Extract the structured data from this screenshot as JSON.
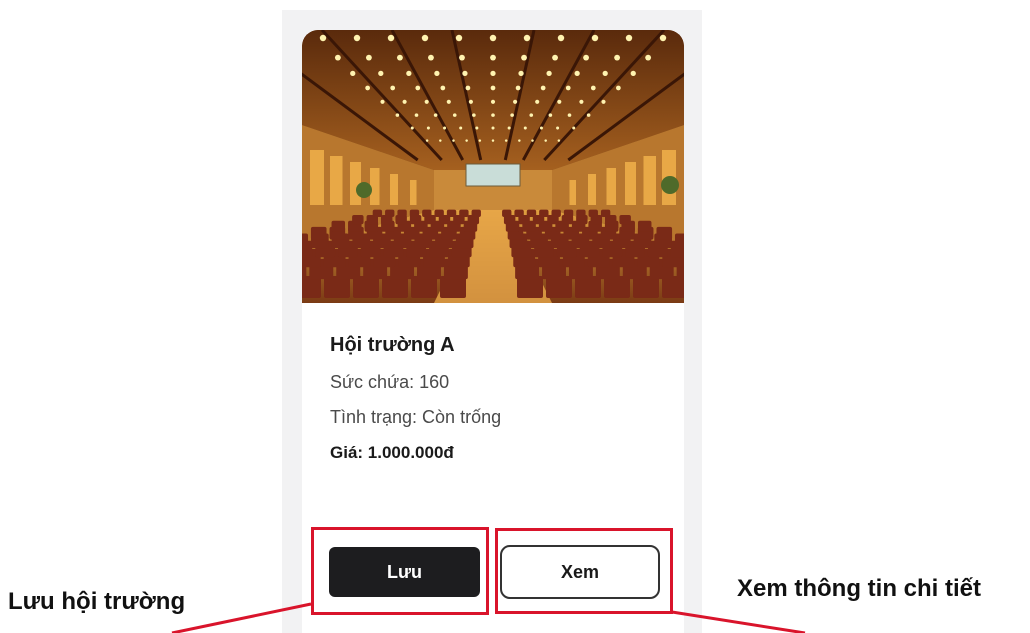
{
  "card": {
    "image": {
      "subject": "conference-hall-photo",
      "colors": {
        "ceiling": "#8a4a1c",
        "light": "#fff3b0",
        "walls": "#b8772e",
        "seats": "#7a2a17",
        "floor": "#d58a2c"
      }
    },
    "hall_name": "Hội trường A",
    "capacity": "Sức chứa: 160",
    "status": "Tình trạng: Còn trống",
    "price": "Giá: 1.000.000đ"
  },
  "buttons": {
    "save_label": "Lưu",
    "view_label": "Xem"
  },
  "annotations": {
    "save_callout": "Lưu hội trường",
    "view_callout": "Xem thông tin chi tiết",
    "highlight_color": "#d9142b"
  },
  "colors": {
    "panel_bg": "#f2f2f3",
    "card_bg": "#ffffff",
    "primary_button": "#1d1d1f"
  }
}
